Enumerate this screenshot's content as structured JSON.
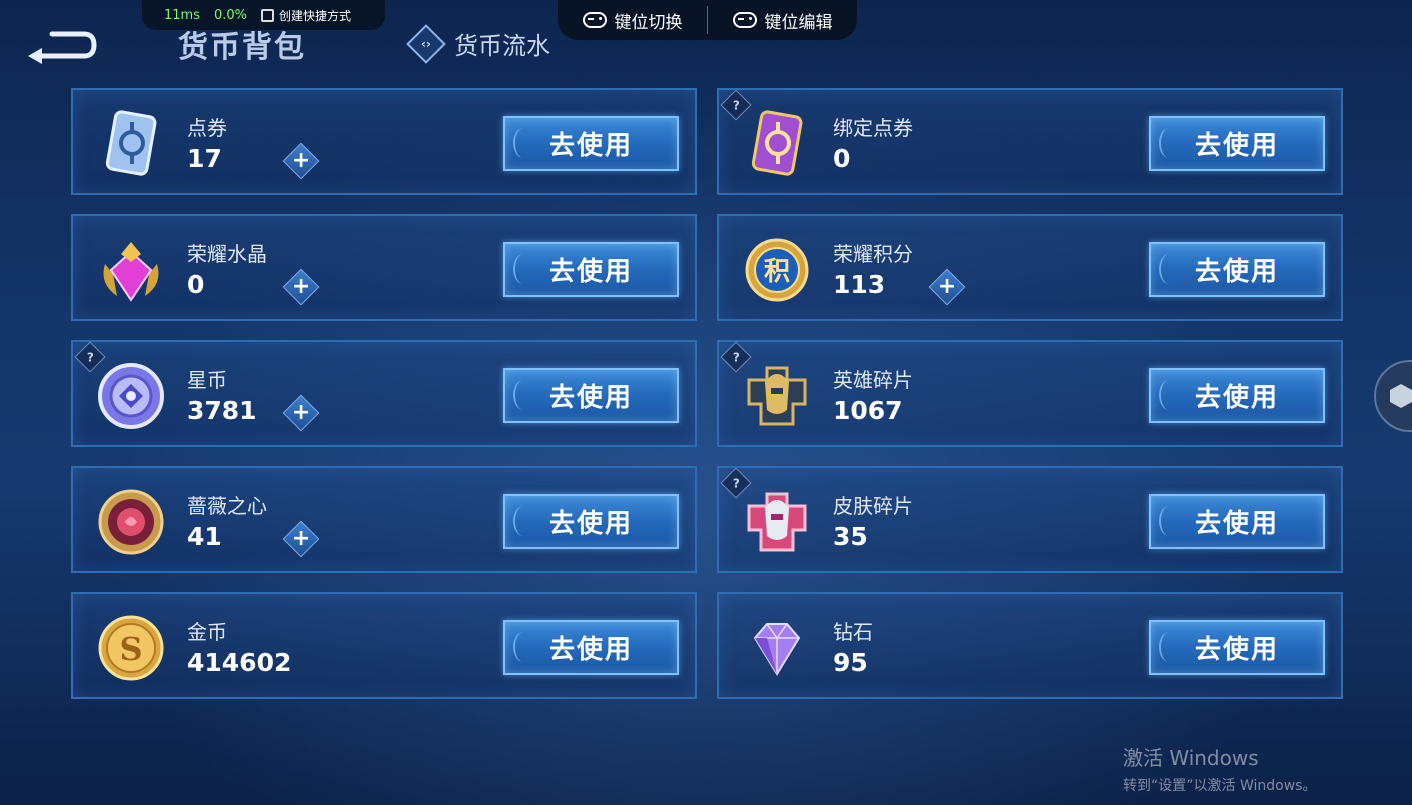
{
  "overlay": {
    "ping": "11ms",
    "cpu": "0.0%",
    "shortcut_label": "创建快捷方式",
    "key_switch_label": "键位切换",
    "key_edit_label": "键位编辑"
  },
  "header": {
    "title": "货币背包",
    "tab_flow_label": "货币流水"
  },
  "currencies": [
    {
      "name": "点券",
      "amount": "17",
      "has_help": false,
      "has_plus": true,
      "icon": "coupon-card-icon",
      "use_label": "去使用"
    },
    {
      "name": "绑定点券",
      "amount": "0",
      "has_help": true,
      "has_plus": false,
      "icon": "bound-coupon-card-icon",
      "use_label": "去使用"
    },
    {
      "name": "荣耀水晶",
      "amount": "0",
      "has_help": false,
      "has_plus": true,
      "icon": "glory-crystal-icon",
      "use_label": "去使用"
    },
    {
      "name": "荣耀积分",
      "amount": "113",
      "has_help": false,
      "has_plus": true,
      "icon": "glory-points-icon",
      "use_label": "去使用"
    },
    {
      "name": "星币",
      "amount": "3781",
      "has_help": true,
      "has_plus": true,
      "icon": "star-coin-icon",
      "use_label": "去使用"
    },
    {
      "name": "英雄碎片",
      "amount": "1067",
      "has_help": true,
      "has_plus": false,
      "icon": "hero-fragment-icon",
      "use_label": "去使用"
    },
    {
      "name": "蔷薇之心",
      "amount": "41",
      "has_help": false,
      "has_plus": true,
      "icon": "rose-heart-icon",
      "use_label": "去使用"
    },
    {
      "name": "皮肤碎片",
      "amount": "35",
      "has_help": true,
      "has_plus": false,
      "icon": "skin-fragment-icon",
      "use_label": "去使用"
    },
    {
      "name": "金币",
      "amount": "414602",
      "has_help": false,
      "has_plus": false,
      "icon": "gold-coin-icon",
      "use_label": "去使用"
    },
    {
      "name": "钻石",
      "amount": "95",
      "has_help": false,
      "has_plus": false,
      "icon": "diamond-icon",
      "use_label": "去使用"
    }
  ],
  "watermark": {
    "title": "激活 Windows",
    "subtitle": "转到“设置”以激活 Windows。"
  }
}
